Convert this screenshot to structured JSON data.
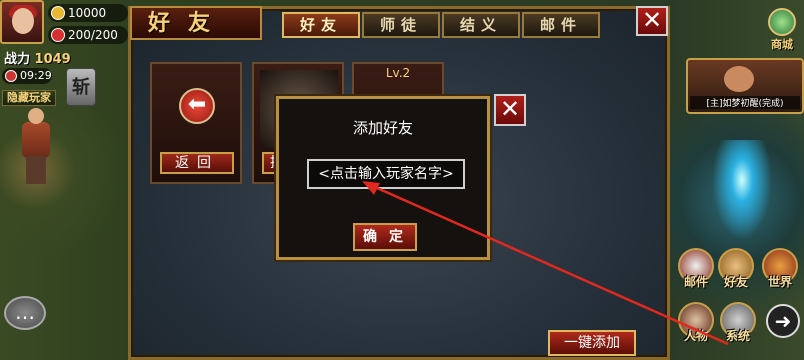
{
  "hud": {
    "gold": "10000",
    "stamina": "200/200",
    "power_label": "战力",
    "power_value": "1049",
    "time": "09:29",
    "hide_player": "隐藏玩家",
    "slash": "斩",
    "chat_icon": "chat-bubble-icon"
  },
  "right_hud": {
    "shop": "商城",
    "quest_text": "[主]如梦初醒(完成)",
    "buttons": [
      "邮件",
      "好友",
      "世界",
      "人物",
      "系统"
    ]
  },
  "panel": {
    "title": "好友",
    "tabs": [
      "好友",
      "师徒",
      "结义",
      "邮件"
    ],
    "active_tab": 0,
    "back_button": "返回",
    "card2_button_partial": "推",
    "card3_level": "Lv.2",
    "one_key_add": "一键添加"
  },
  "dialog": {
    "title": "添加好友",
    "input_placeholder": "<点击输入玩家名字>",
    "confirm": "确定"
  },
  "colors": {
    "gold": "#f7d27a",
    "frame": "#b89040",
    "red_button": "#9a2a1a",
    "annotation": "#e0281e"
  }
}
